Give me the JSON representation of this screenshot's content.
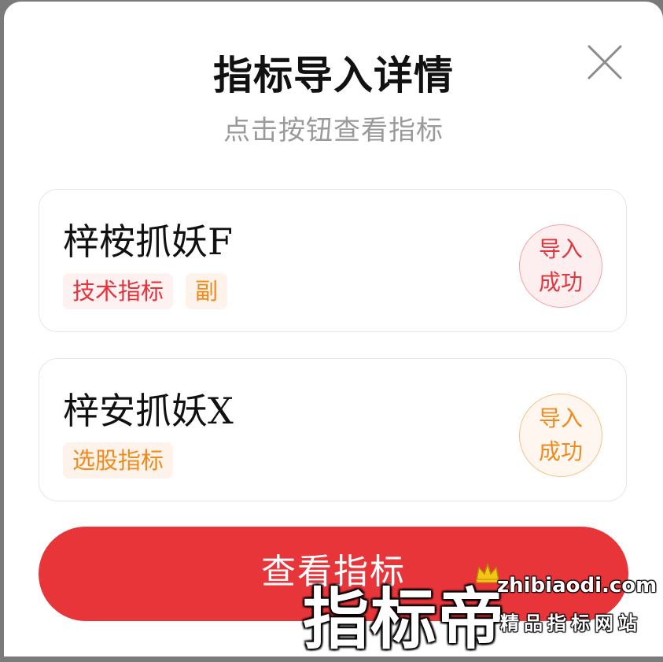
{
  "dialog": {
    "title": "指标导入详情",
    "subtitle": "点击按钮查看指标",
    "close_icon": "close-icon"
  },
  "indicators": [
    {
      "name": "梓桉抓妖F",
      "tags": [
        {
          "label": "技术指标",
          "color": "#e8333a"
        },
        {
          "label": "副",
          "color": "#f08a1c"
        }
      ],
      "status": {
        "line1": "导入",
        "line2": "成功",
        "color": "#e2373e"
      }
    },
    {
      "name": "梓安抓妖X",
      "tags": [
        {
          "label": "选股指标",
          "color": "#f08a1c"
        }
      ],
      "status": {
        "line1": "导入",
        "line2": "成功",
        "color": "#ee8a1e"
      }
    }
  ],
  "primary_button": {
    "label": "查看指标",
    "color": "#e8353a"
  },
  "watermark": {
    "brand": "指标帝",
    "url": "zhibiaodi.com",
    "slogan": "精品指标网站",
    "icon": "crown-icon"
  }
}
